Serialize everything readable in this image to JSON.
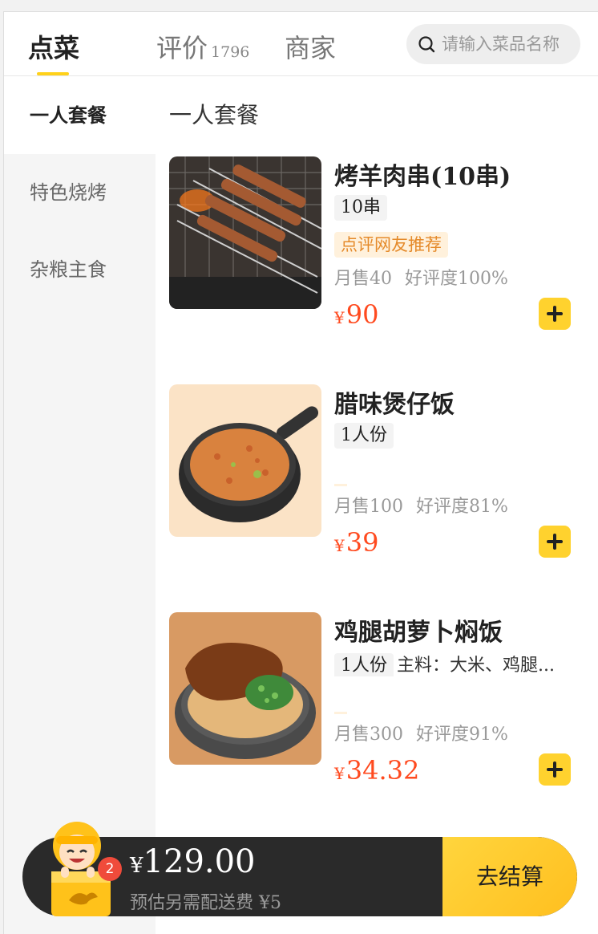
{
  "tabs": [
    {
      "label": "点菜"
    },
    {
      "label": "评价",
      "count": "1796"
    },
    {
      "label": "商家"
    }
  ],
  "search": {
    "placeholder": "请输入菜品名称"
  },
  "sidebar": {
    "items": [
      {
        "label": "一人套餐"
      },
      {
        "label": "特色烧烤"
      },
      {
        "label": "杂粮主食"
      }
    ]
  },
  "main": {
    "category_title": "一人套餐",
    "dishes": [
      {
        "name": "烤羊肉串(10串)",
        "tag": "10串",
        "recommend": "点评网友推荐",
        "monthly_sales": "月售40",
        "rating": "好评度100%",
        "currency": "¥",
        "price": "90"
      },
      {
        "name": "腊味煲仔饭",
        "tag": "1人份",
        "monthly_sales": "月售100",
        "rating": "好评度81%",
        "currency": "¥",
        "price": "39"
      },
      {
        "name": "鸡腿胡萝卜焖饭",
        "tag": "1人份",
        "ingredients": "主料：大米、鸡腿...",
        "monthly_sales": "月售300",
        "rating": "好评度91%",
        "currency": "¥",
        "price": "34.32"
      }
    ]
  },
  "cart": {
    "badge_count": "2",
    "currency": "¥",
    "total": "129.00",
    "delivery_note": "预估另需配送费 ¥5",
    "checkout_label": "去结算"
  }
}
